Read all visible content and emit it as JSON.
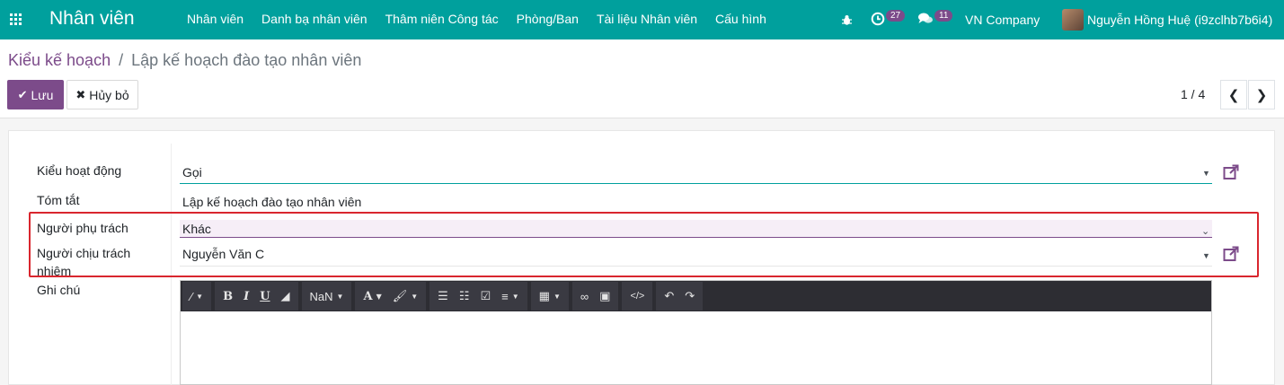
{
  "navbar": {
    "brand": "Nhân viên",
    "menu": [
      "Nhân viên",
      "Danh bạ nhân viên",
      "Thâm niên Công tác",
      "Phòng/Ban",
      "Tài liệu Nhân viên",
      "Cấu hình"
    ],
    "activity_count": "27",
    "message_count": "11",
    "company": "VN Company",
    "user": "Nguyễn Hồng Huệ (i9zclhb7b6i4)"
  },
  "breadcrumb": {
    "parent": "Kiểu kế hoạch",
    "separator": "/",
    "current": "Lập kế hoạch đào tạo nhân viên"
  },
  "actions": {
    "save_label": "Lưu",
    "cancel_label": "Hủy bỏ"
  },
  "pager": {
    "value": "1 / 4"
  },
  "form": {
    "activity_type": {
      "label": "Kiểu hoạt động",
      "value": "Gọi"
    },
    "summary": {
      "label": "Tóm tắt",
      "value": "Lập kế hoạch đào tạo nhân viên"
    },
    "assigned_to": {
      "label": "Người phụ trách",
      "value": "Khác"
    },
    "responsible": {
      "label_line1": "Người chịu trách",
      "label_line2": "nhiệm",
      "value": "Nguyễn Văn C"
    },
    "note": {
      "label": "Ghi chú"
    }
  },
  "editor_toolbar": {
    "font_size_label": "NaN"
  },
  "colors": {
    "navbar": "#00a09d",
    "primary": "#7c4b8a",
    "highlight_border": "#d9262e"
  }
}
